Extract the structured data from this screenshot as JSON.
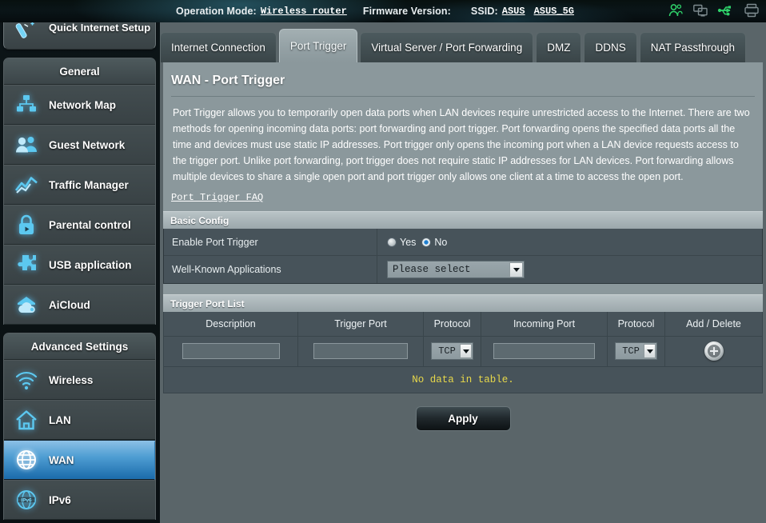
{
  "topbar": {
    "operation_mode_label": "Operation Mode:",
    "operation_mode_value": "Wireless router",
    "firmware_label": "Firmware Version:",
    "firmware_value": "",
    "ssid_label": "SSID:",
    "ssid_1": "ASUS",
    "ssid_2": "ASUS_5G",
    "icons": [
      "users-icon",
      "devices-icon",
      "usb-icon",
      "printer-icon"
    ]
  },
  "sidebar": {
    "quick_setup": {
      "label": "Quick Internet Setup",
      "icon": "magic-wand-icon"
    },
    "groups": [
      {
        "title": "General",
        "items": [
          {
            "label": "Network Map",
            "icon": "network-map-icon",
            "active": false
          },
          {
            "label": "Guest Network",
            "icon": "guest-network-icon",
            "active": false
          },
          {
            "label": "Traffic Manager",
            "icon": "traffic-manager-icon",
            "active": false
          },
          {
            "label": "Parental control",
            "icon": "lock-icon",
            "active": false
          },
          {
            "label": "USB application",
            "icon": "puzzle-icon",
            "active": false
          },
          {
            "label": "AiCloud",
            "icon": "cloud-icon",
            "active": false
          }
        ]
      },
      {
        "title": "Advanced Settings",
        "items": [
          {
            "label": "Wireless",
            "icon": "wifi-icon",
            "active": false
          },
          {
            "label": "LAN",
            "icon": "home-icon",
            "active": false
          },
          {
            "label": "WAN",
            "icon": "globe-icon",
            "active": true
          },
          {
            "label": "IPv6",
            "icon": "ipv6-globe-icon",
            "active": false
          }
        ]
      }
    ]
  },
  "tabs": [
    {
      "label": "Internet Connection",
      "active": false
    },
    {
      "label": "Port Trigger",
      "active": true
    },
    {
      "label": "Virtual Server / Port Forwarding",
      "active": false
    },
    {
      "label": "DMZ",
      "active": false
    },
    {
      "label": "DDNS",
      "active": false
    },
    {
      "label": "NAT Passthrough",
      "active": false
    }
  ],
  "main": {
    "title": "WAN - Port Trigger",
    "description": "Port Trigger allows you to temporarily open data ports when LAN devices require unrestricted access to the Internet. There are two methods for opening incoming data ports: port forwarding and port trigger. Port forwarding opens the specified data ports all the time and devices must use static IP addresses. Port trigger only opens the incoming port when a LAN device requests access to the trigger port. Unlike port forwarding, port trigger does not require static IP addresses for LAN devices. Port forwarding allows multiple devices to share a single open port and port trigger only allows one client at a time to access the open port.",
    "faq_link": "Port Trigger FAQ",
    "basic_config": {
      "section_title": "Basic Config",
      "enable_label": "Enable Port Trigger",
      "radio_yes": "Yes",
      "radio_no": "No",
      "selected": "No",
      "well_known_label": "Well-Known Applications",
      "well_known_value": "Please select"
    },
    "trigger_port_list": {
      "section_title": "Trigger Port List",
      "columns": [
        "Description",
        "Trigger Port",
        "Protocol",
        "Incoming Port",
        "Protocol",
        "Add / Delete"
      ],
      "entry_row": {
        "description": "",
        "description_placeholder": "",
        "trigger_port": "",
        "trigger_port_placeholder": "",
        "protocol_1": "TCP",
        "incoming_port": "",
        "incoming_port_placeholder": "",
        "protocol_2": "TCP",
        "add_icon": "plus-circle-icon"
      },
      "empty_message": "No data in table."
    },
    "apply_label": "Apply"
  },
  "colors": {
    "accent_blue": "#2f7cb6",
    "panel_bg": "#47535a",
    "page_bg": "#5a6569",
    "warning_yellow": "#e7d84a"
  }
}
